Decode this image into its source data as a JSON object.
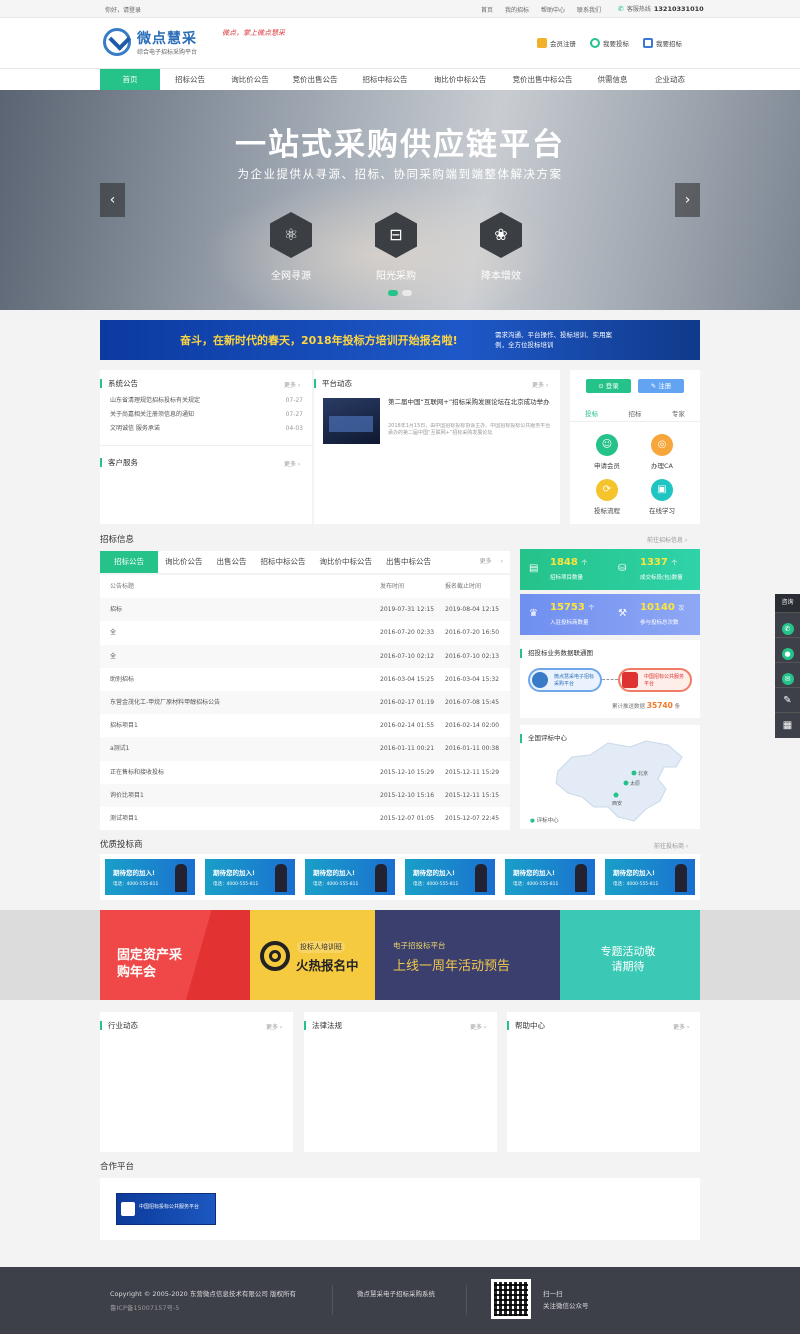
{
  "topbar": {
    "greeting": "你好，请登录",
    "links": [
      "首页",
      "我的招标",
      "帮助中心",
      "联系我们"
    ],
    "hotline_label": "客服热线",
    "hotline": "13210331010"
  },
  "header": {
    "brand": "微点慧采",
    "brand_sub": "综合电子招标采购平台",
    "slogan": "微点，掌上微点慧采",
    "links": [
      "会员注册",
      "我要投标",
      "我要招标"
    ]
  },
  "nav": [
    "首页",
    "招标公告",
    "询比价公告",
    "竞价出售公告",
    "招标中标公告",
    "询比价中标公告",
    "竞价出售中标公告",
    "供需信息",
    "企业动态"
  ],
  "banner": {
    "title": "一站式采购供应链平台",
    "subtitle": "为企业提供从寻源、招标、协同采购端到端整体解决方案",
    "features": [
      {
        "label": "全网寻源",
        "icon": "atom-icon"
      },
      {
        "label": "阳光采购",
        "icon": "basket-icon"
      },
      {
        "label": "降本增效",
        "icon": "lotus-icon"
      }
    ]
  },
  "ad": {
    "title": "奋斗，在新时代的春天，2018年投标方培训开始报名啦!",
    "text": "需求沟通、平台操作、投标培训、实用案例，全方位投标培训"
  },
  "notice": {
    "title": "系统公告",
    "more": "更多",
    "items": [
      {
        "text": "山东省清理规范招标投标有关规定",
        "date": "07-27"
      },
      {
        "text": "关于尚嘉相关注册须信息的通知",
        "date": "07-27"
      },
      {
        "text": "文明诚信 服务承诺",
        "date": "04-03"
      }
    ]
  },
  "service": {
    "title": "客户服务",
    "more": "更多"
  },
  "platform": {
    "title": "平台动态",
    "more": "更多",
    "news_title": "第二届中国“互联网+”招标采购发展论坛在北京成功举办",
    "news_text": "2018年1月15日，由中国招标投标协会主办、中国招标投标公共服务平台承办的第二届中国“互联网+”招标采购发展论坛"
  },
  "login": {
    "login": "登录",
    "register": "注册",
    "tabs": [
      "投标",
      "招标",
      "专家"
    ],
    "items": [
      "申请会员",
      "办理CA",
      "投标流程",
      "在线学习"
    ]
  },
  "bids": {
    "title": "招标信息",
    "link": "前往招标信息",
    "tabs": [
      "招标公告",
      "询比价公告",
      "出售公告",
      "招标中标公告",
      "询比价中标公告",
      "出售中标公告"
    ],
    "more": "更多",
    "head": [
      "公告标题",
      "发布时间",
      "报名截止时间"
    ],
    "rows": [
      [
        "招标",
        "2019-07-31 12:15",
        "2019-08-04 12:15"
      ],
      [
        "全",
        "2016-07-20 02:33",
        "2016-07-20 16:50"
      ],
      [
        "全",
        "2016-07-10 02:12",
        "2016-07-10 02:13"
      ],
      [
        "助别招标",
        "2016-03-04 15:25",
        "2016-03-04 15:32"
      ],
      [
        "东营金茂化工-甲烷厂原材料甲醇招标公告",
        "2016-02-17 01:19",
        "2016-07-08 15:45"
      ],
      [
        "招标项目1",
        "2016-02-14 01:55",
        "2016-02-14 02:00"
      ],
      [
        "a测试1",
        "2016-01-11 00:21",
        "2016-01-11 00:38"
      ],
      [
        "正在售标和接收投标",
        "2015-12-10 15:29",
        "2015-12-11 15:29"
      ],
      [
        "询价比项目1",
        "2015-12-10 15:16",
        "2015-12-11 15:15"
      ],
      [
        "测试项目1",
        "2015-12-07 01:05",
        "2015-12-07 22:45"
      ]
    ]
  },
  "stats": [
    {
      "num": "1848",
      "unit": "个",
      "label": "招标项目数量"
    },
    {
      "num": "1337",
      "unit": "个",
      "label": "成交标段(包)数量"
    },
    {
      "num": "15753",
      "unit": "个",
      "label": "入驻投标商数量"
    },
    {
      "num": "10140",
      "unit": "次",
      "label": "参与投标总次数"
    }
  ],
  "linkage": {
    "title": "招投标业务数据联通图",
    "left": "微点慧采电子招标采购平台",
    "right": "中国招标公共服务平台",
    "count_label": "累计推送数据",
    "count": "35740",
    "unit": "条"
  },
  "review": {
    "title": "全国评标中心",
    "cities": [
      "北京",
      "太原",
      "西安"
    ],
    "legend": "评标中心"
  },
  "suppliers": {
    "title": "优质投标商",
    "link": "前往投标商",
    "card_title": "期待您的加入!",
    "card_phone": "电话：4000-555-811",
    "count": 6
  },
  "promos": [
    {
      "text": "固定资产采购年会",
      "color": "#f04848"
    },
    {
      "tag": "投标人培训班",
      "text": "火热报名中",
      "color": "#f6ca3e"
    },
    {
      "tag": "电子招投标平台",
      "text": "上线一周年活动预告",
      "color": "#3b3f6e"
    },
    {
      "text": "专题活动敬请期待",
      "color": "#3bc9b6"
    }
  ],
  "bottom_panels": [
    {
      "title": "行业动态",
      "more": "更多"
    },
    {
      "title": "法律法规",
      "more": "更多"
    },
    {
      "title": "帮助中心",
      "more": "更多"
    }
  ],
  "partner": {
    "title": "合作平台",
    "logo": "中国招标投标公共服务平台"
  },
  "footer": {
    "copyright": "Copyright © 2005-2020 东营微点信息技术有限公司 版权所有",
    "icp": "鲁ICP备15007157号-5",
    "system": "微点慧采电子招标采购系统",
    "scan": "扫一扫",
    "follow": "关注微信公众号"
  },
  "sidebar": {
    "consult": "咨询"
  }
}
